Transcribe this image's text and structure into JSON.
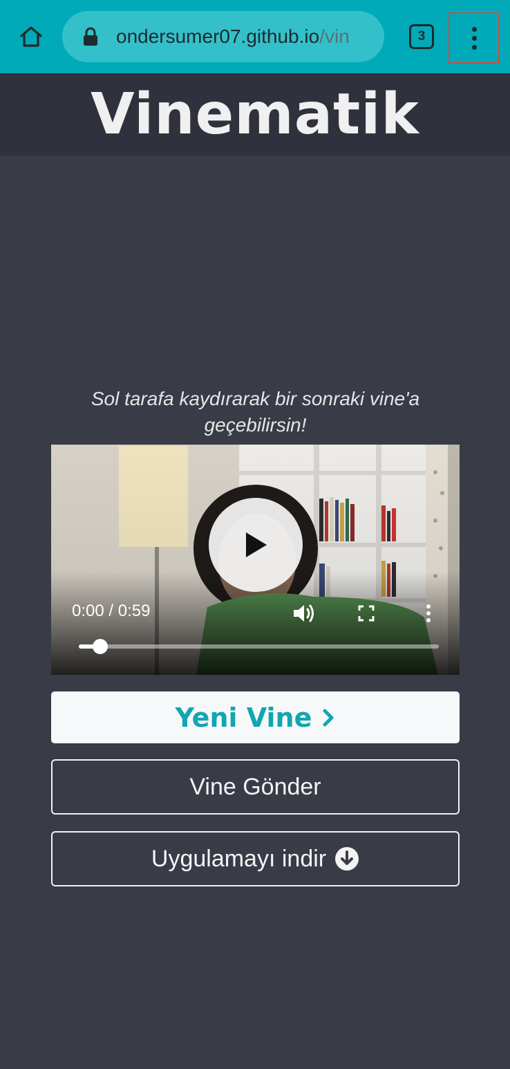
{
  "browser": {
    "url_host": "ondersumer07.github.io",
    "url_path": "/vin",
    "tab_count": "3"
  },
  "site": {
    "title": "Vinematik"
  },
  "instruction": "Sol tarafa kaydırarak bir sonraki vine'a geçebilirsin!",
  "video": {
    "time": "0:00 / 0:59",
    "progress_fraction": 0.06
  },
  "buttons": {
    "new_vine": "Yeni Vine",
    "send_vine": "Vine Gönder",
    "download_app": "Uygulamayı indir"
  },
  "colors": {
    "browser_bar": "#00aab8",
    "page_bg": "#393c47",
    "header_bg": "#2f323c",
    "accent": "#10a6b2"
  },
  "icons": [
    "home-icon",
    "lock-icon",
    "tabs-icon",
    "more-vert-icon",
    "play-icon",
    "volume-icon",
    "fullscreen-icon",
    "chevron-right-icon",
    "download-circle-icon"
  ]
}
